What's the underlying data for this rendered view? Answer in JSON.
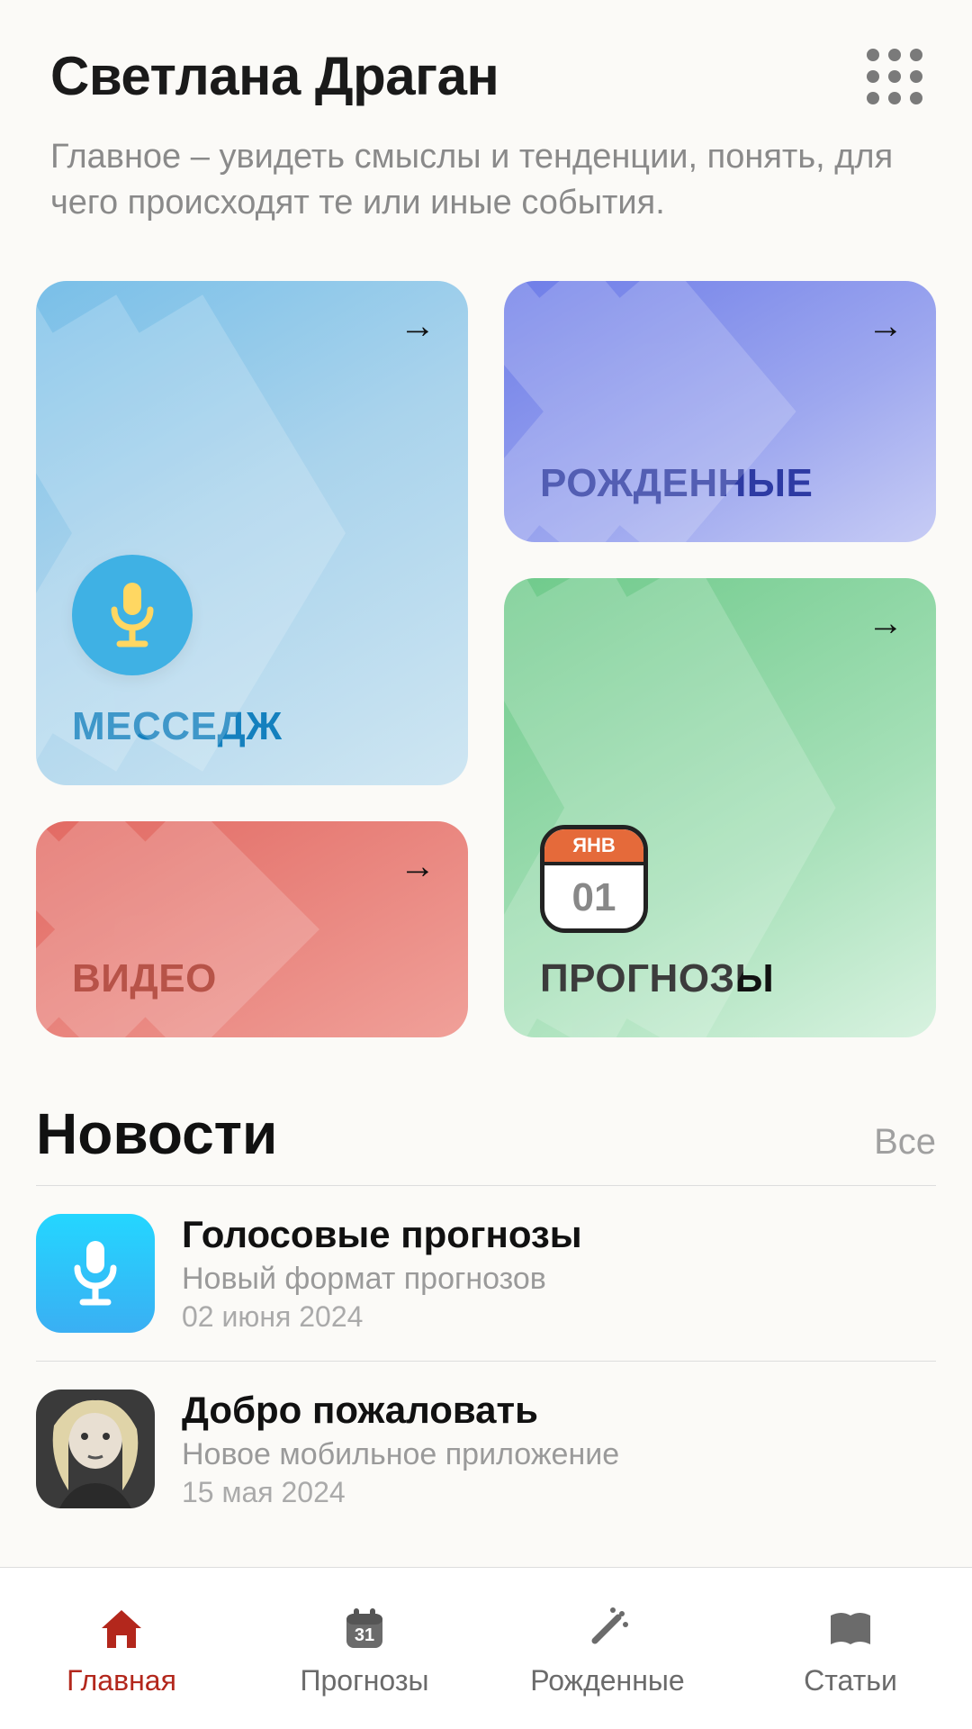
{
  "header": {
    "title": "Светлана Драган",
    "subtitle": "Главное – увидеть смыслы и тенденции, понять, для чего происходят те или иные события."
  },
  "cards": {
    "message": {
      "label": "МЕССЕДЖ",
      "icon": "microphone-icon"
    },
    "video": {
      "label": "ВИДЕО"
    },
    "born": {
      "label": "РОЖДЕННЫЕ"
    },
    "forecast": {
      "label": "ПРОГНОЗЫ",
      "cal_month": "ЯНВ",
      "cal_day": "01"
    }
  },
  "news": {
    "heading": "Новости",
    "all_label": "Все",
    "items": [
      {
        "title": "Голосовые прогнозы",
        "subtitle": "Новый формат прогнозов",
        "date": "02 июня 2024",
        "thumb": "mic"
      },
      {
        "title": "Добро пожаловать",
        "subtitle": "Новое мобильное приложение",
        "date": "15 мая 2024",
        "thumb": "portrait"
      }
    ]
  },
  "tabs": [
    {
      "label": "Главная",
      "active": true
    },
    {
      "label": "Прогнозы",
      "active": false
    },
    {
      "label": "Рожденные",
      "active": false
    },
    {
      "label": "Статьи",
      "active": false
    }
  ]
}
